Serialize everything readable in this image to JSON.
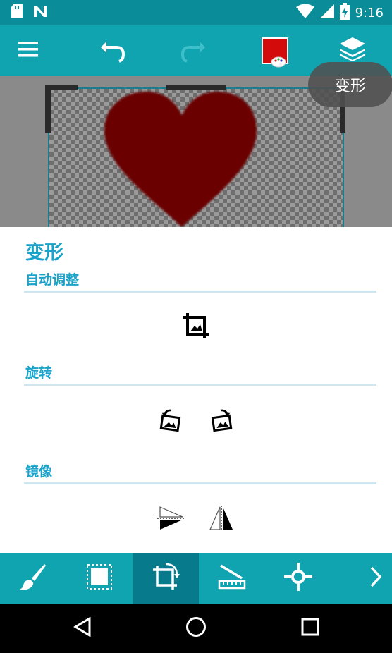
{
  "status_bar": {
    "time": "9:16",
    "icons": [
      "sd-card-icon",
      "n-notification-icon",
      "wifi-icon",
      "signal-icon",
      "battery-charging-icon"
    ]
  },
  "toolbar": {
    "menu_icon": "menu-icon",
    "undo_icon": "undo-icon",
    "redo_icon": "redo-icon",
    "color_swatch": "#d40b0b",
    "layers_icon": "layers-icon"
  },
  "tooltip": {
    "text": "变形"
  },
  "canvas": {
    "heart_color": "#6b0000"
  },
  "panel": {
    "title": "变形",
    "sections": [
      {
        "label": "自动调整",
        "tools": [
          "crop-icon"
        ]
      },
      {
        "label": "旋转",
        "tools": [
          "rotate-left-icon",
          "rotate-right-icon"
        ]
      },
      {
        "label": "镜像",
        "tools": [
          "flip-vertical-icon",
          "flip-horizontal-icon"
        ]
      }
    ]
  },
  "bottom_tools": {
    "items": [
      "brush-icon",
      "selection-icon",
      "transform-icon",
      "line-ruler-icon",
      "cursor-icon",
      "more-arrow-icon"
    ],
    "active": "transform-icon"
  },
  "nav_bar": {
    "buttons": [
      "back-icon",
      "home-icon",
      "recents-icon"
    ]
  },
  "colors": {
    "status_bar": "#0a8d99",
    "toolbar": "#10a4b0",
    "accent": "#1aa3c9",
    "active_tool": "#077a8c"
  }
}
